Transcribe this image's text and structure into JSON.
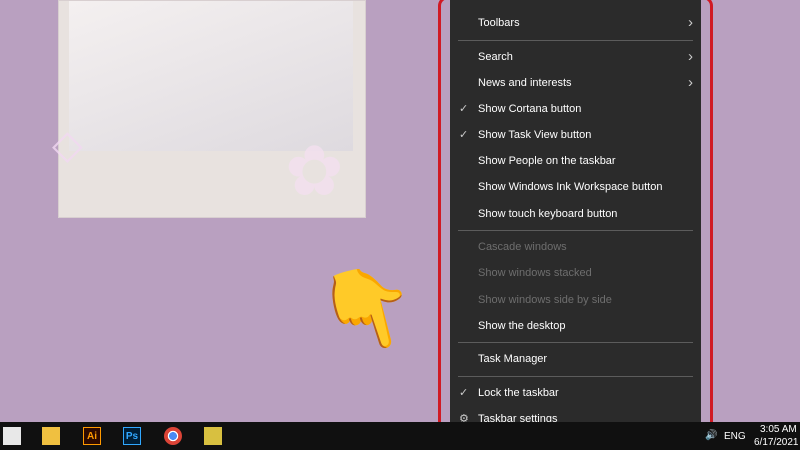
{
  "menu": {
    "items": [
      {
        "label": "Toolbars",
        "submenu": true,
        "checked": false,
        "disabled": false
      },
      {
        "label": "Search",
        "submenu": true,
        "checked": false,
        "disabled": false
      },
      {
        "label": "News and interests",
        "submenu": true,
        "checked": false,
        "disabled": false
      },
      {
        "label": "Show Cortana button",
        "submenu": false,
        "checked": true,
        "disabled": false
      },
      {
        "label": "Show Task View button",
        "submenu": false,
        "checked": true,
        "disabled": false
      },
      {
        "label": "Show People on the taskbar",
        "submenu": false,
        "checked": false,
        "disabled": false
      },
      {
        "label": "Show Windows Ink Workspace button",
        "submenu": false,
        "checked": false,
        "disabled": false
      },
      {
        "label": "Show touch keyboard button",
        "submenu": false,
        "checked": false,
        "disabled": false
      },
      {
        "label": "Cascade windows",
        "submenu": false,
        "checked": false,
        "disabled": true
      },
      {
        "label": "Show windows stacked",
        "submenu": false,
        "checked": false,
        "disabled": true
      },
      {
        "label": "Show windows side by side",
        "submenu": false,
        "checked": false,
        "disabled": true
      },
      {
        "label": "Show the desktop",
        "submenu": false,
        "checked": false,
        "disabled": false
      },
      {
        "label": "Task Manager",
        "submenu": false,
        "checked": false,
        "disabled": false
      },
      {
        "label": "Lock the taskbar",
        "submenu": false,
        "checked": true,
        "disabled": false
      },
      {
        "label": "Taskbar settings",
        "submenu": false,
        "checked": false,
        "disabled": false,
        "icon": "gear-icon"
      }
    ]
  },
  "taskbar": {
    "apps": [
      {
        "name": "microsoft-store-icon",
        "label": ""
      },
      {
        "name": "file-explorer-icon",
        "label": ""
      },
      {
        "name": "illustrator-icon",
        "label": "Ai"
      },
      {
        "name": "photoshop-icon",
        "label": "Ps"
      },
      {
        "name": "chrome-icon",
        "label": ""
      },
      {
        "name": "game-icon",
        "label": ""
      }
    ],
    "language": "ENG",
    "time": "3:05 AM",
    "date": "6/17/2021"
  },
  "colors": {
    "highlight_border": "#d01a24",
    "menu_bg": "#2b2b2b",
    "desktop": "#b9a0c0"
  }
}
